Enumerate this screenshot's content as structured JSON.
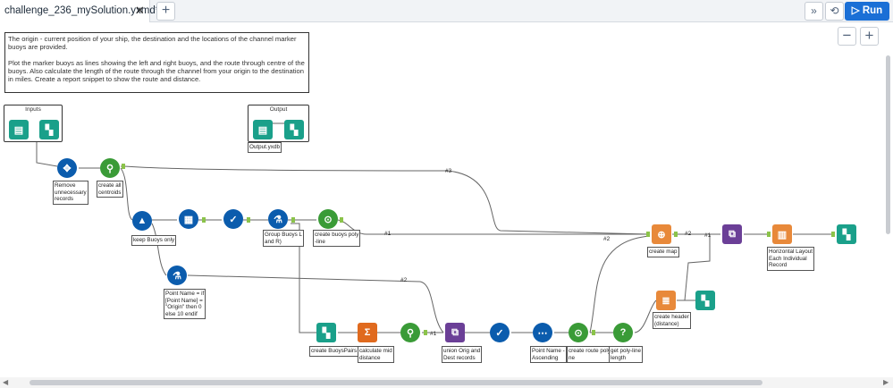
{
  "tabbar": {
    "tab_title": "challenge_236_mySolution.yxmd*",
    "close_glyph": "✕",
    "add_glyph": "+",
    "expand_glyph": "»",
    "history_glyph": "⟲",
    "run_label": "▷ Run"
  },
  "canvas": {
    "zoom_out": "−",
    "zoom_in": "+",
    "comment": "The origin - current position of your ship, the destination and the locations of the channel marker buoys are provided.\n\nPlot the marker buoys as lines showing the left and right buoys, and the route through centre of the buoys. Also calculate the length of the route through the channel from your origin to the destination in miles. Create a report snippet to show the route and distance.",
    "containers": {
      "inputs": "Inputs",
      "output": "Output"
    },
    "labels": {
      "output_file": "Output.yxdb",
      "remove": "Remove\nunnecessary\nrecords",
      "centroids": "create all\ncentroids",
      "keep_buoys": "keep Buoys only",
      "group_buoys": "Group Buoys   L\nand R)",
      "poly_line": "create buoys poly\n-line",
      "point_name": "Point Name = if\n[Point Name] =\n\"Origin\" then 0\nelse 10 endif",
      "buoy_pairs": "create BuoysPairs",
      "mid_distance": "calculate mid\ndistance",
      "union": "union Orig and\nDest records",
      "ascending": "Point Name -\nAscending",
      "route_poly": "create route poly-\nne",
      "poly_length": "get poly-line\nlength",
      "create_map": "create map",
      "create_header": "create header\n(distance)",
      "horizontal_layout": "Horizontal Layout\nEach Individual\nRecord"
    },
    "wire_labels": {
      "w3": "#3",
      "w1a": "#1",
      "w2a": "#2",
      "w2b": "#2",
      "w1b": "#1",
      "w2c": "#2",
      "w1c": "#1"
    }
  },
  "icons": {
    "input_book": "input-data-icon",
    "browse": "browse-binoculars-icon",
    "select": "select-arrows-icon",
    "centroid": "spatial-centroid-icon",
    "filter": "filter-icon",
    "database": "data-cleansing-icon",
    "sample": "sample-icon",
    "formula": "formula-flask-icon",
    "poly_build": "poly-build-icon",
    "summarize": "summarize-sigma-icon",
    "union": "union-icon",
    "sort": "sort-icon",
    "map": "report-map-icon",
    "layout": "layout-icon",
    "text": "report-text-icon",
    "help": "question-icon"
  },
  "colors": {
    "input": "#1aa08a",
    "prep": "#0b5cad",
    "spatial": "#3a9b37",
    "summarize": "#e06a1e",
    "join": "#6b3f97",
    "report": "#e8893a",
    "run": "#1a6fd6"
  }
}
